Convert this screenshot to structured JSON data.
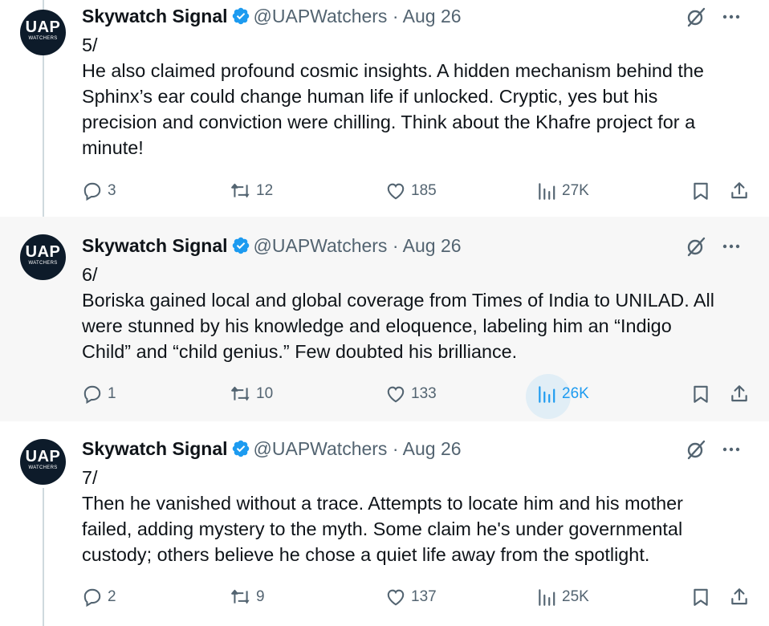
{
  "tweets": [
    {
      "avatar": {
        "line1": "UAP",
        "line2": "WATCHERS"
      },
      "name": "Skywatch Signal",
      "handle": "@UAPWatchers",
      "separator": "·",
      "date": "Aug 26",
      "text_lines": [
        "5/",
        "He also claimed profound cosmic insights. A hidden mechanism behind the",
        "Sphinx’s ear could change human life if unlocked. Cryptic, yes but his",
        "precision and conviction were chilling. Think about the Khafre project for a",
        "minute!"
      ],
      "stats": {
        "replies": "3",
        "reposts": "12",
        "likes": "185",
        "views": "27K"
      }
    },
    {
      "avatar": {
        "line1": "UAP",
        "line2": "WATCHERS"
      },
      "name": "Skywatch Signal",
      "handle": "@UAPWatchers",
      "separator": "·",
      "date": "Aug 26",
      "text_lines": [
        "6/",
        "Boriska gained local and global coverage from Times of India to UNILAD. All",
        "were stunned by his knowledge and eloquence, labeling him an “Indigo",
        "Child” and “child genius.” Few doubted his brilliance."
      ],
      "stats": {
        "replies": "1",
        "reposts": "10",
        "likes": "133",
        "views": "26K"
      }
    },
    {
      "avatar": {
        "line1": "UAP",
        "line2": "WATCHERS"
      },
      "name": "Skywatch Signal",
      "handle": "@UAPWatchers",
      "separator": "·",
      "date": "Aug 26",
      "text_lines": [
        "7/",
        "Then he vanished without a trace. Attempts to locate him and his mother",
        "failed, adding mystery to the myth. Some claim he's under governmental",
        "custody; others believe he chose a quiet life away from the spotlight."
      ],
      "stats": {
        "replies": "2",
        "reposts": "9",
        "likes": "137",
        "views": "25K"
      }
    }
  ],
  "colors": {
    "accent": "#1d9bf0",
    "muted": "#536471",
    "hover_bg": "#f7f7f7",
    "thread_line": "#cfd9de"
  },
  "icons": [
    "verified-badge-icon",
    "grok-icon",
    "more-icon",
    "reply-icon",
    "repost-icon",
    "like-icon",
    "views-icon",
    "bookmark-icon",
    "share-icon"
  ]
}
